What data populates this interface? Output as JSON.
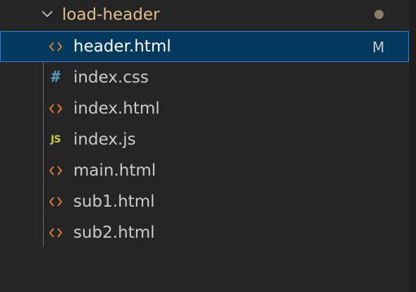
{
  "folder": {
    "name": "load-header",
    "expanded": true,
    "icon": "chevron-down-icon",
    "label_color": "#e2c08d",
    "has_changes_dot": true
  },
  "files": [
    {
      "name": "header.html",
      "icon": "html-file-icon",
      "icon_color": "#e37933",
      "selected": true,
      "git_status": "M"
    },
    {
      "name": "index.css",
      "icon": "css-file-icon",
      "icon_color": "#519aba",
      "selected": false,
      "git_status": ""
    },
    {
      "name": "index.html",
      "icon": "html-file-icon",
      "icon_color": "#e37933",
      "selected": false,
      "git_status": ""
    },
    {
      "name": "index.js",
      "icon": "js-file-icon",
      "icon_color": "#cbcb41",
      "selected": false,
      "git_status": ""
    },
    {
      "name": "main.html",
      "icon": "html-file-icon",
      "icon_color": "#e37933",
      "selected": false,
      "git_status": ""
    },
    {
      "name": "sub1.html",
      "icon": "html-file-icon",
      "icon_color": "#e37933",
      "selected": false,
      "git_status": ""
    },
    {
      "name": "sub2.html",
      "icon": "html-file-icon",
      "icon_color": "#e37933",
      "selected": false,
      "git_status": ""
    }
  ],
  "colors": {
    "background": "#252526",
    "selection_background": "#04395e",
    "selection_border": "#2f7fd6",
    "text": "#cccccc"
  }
}
